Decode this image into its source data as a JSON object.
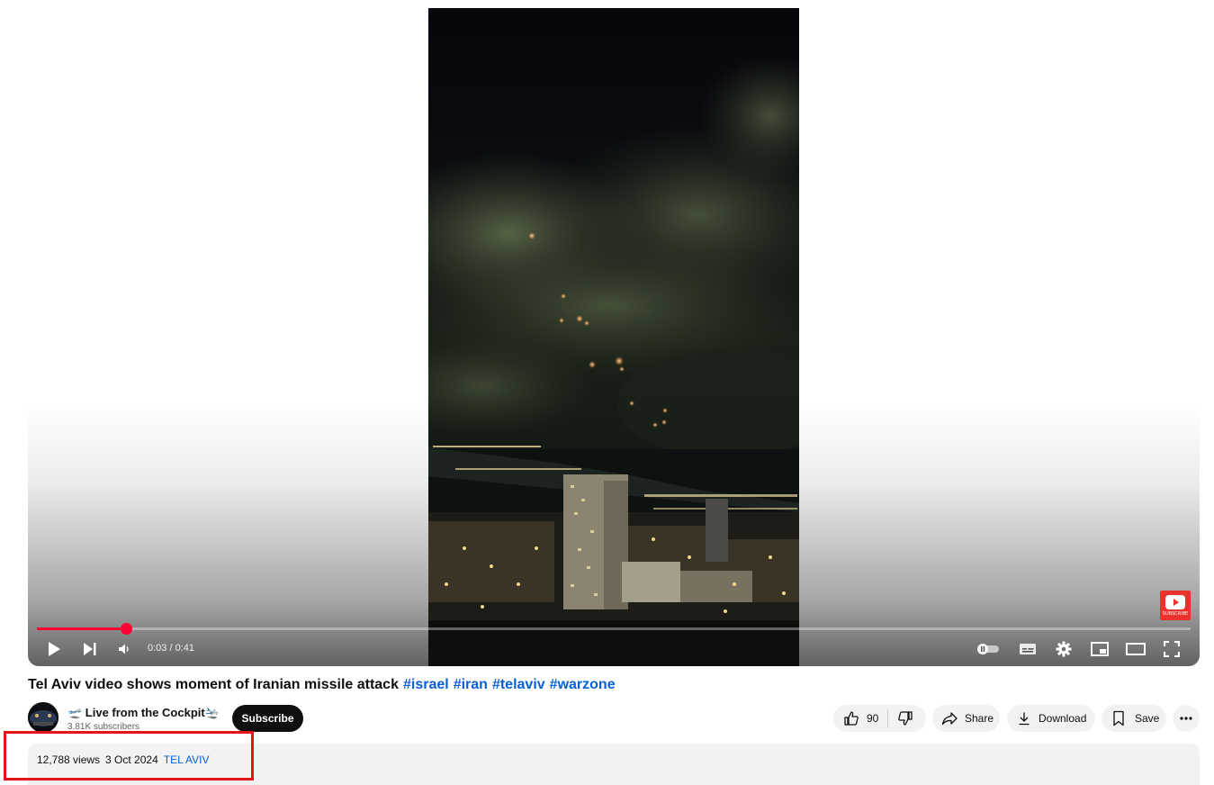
{
  "video": {
    "title": "Tel Aviv video shows moment of Iranian missile attack",
    "hashtags": [
      "#israel",
      "#iran",
      "#telaviv",
      "#warzone"
    ],
    "progress_fraction": 0.077,
    "current_time": "0:03",
    "duration": "0:41",
    "time_display": "0:03 / 0:41",
    "watermark_label": "SUBSCRIBE"
  },
  "controls": {
    "icons": [
      "play-icon",
      "next-icon",
      "volume-icon",
      "autoplay-toggle-icon",
      "subtitles-icon",
      "settings-icon",
      "miniplayer-icon",
      "theater-mode-icon",
      "fullscreen-icon"
    ]
  },
  "channel": {
    "name": "🛫 Live from the Cockpit🛬",
    "subscribers": "3.81K subscribers",
    "subscribe_label": "Subscribe"
  },
  "actions": {
    "like_count": "90",
    "share_label": "Share",
    "download_label": "Download",
    "save_label": "Save"
  },
  "description": {
    "views": "12,788 views",
    "date": "3 Oct 2024",
    "location": "TEL AVIV"
  },
  "colors": {
    "accent_red": "#ff0033",
    "link_blue": "#065fd4",
    "highlight_red": "#e3161c"
  }
}
